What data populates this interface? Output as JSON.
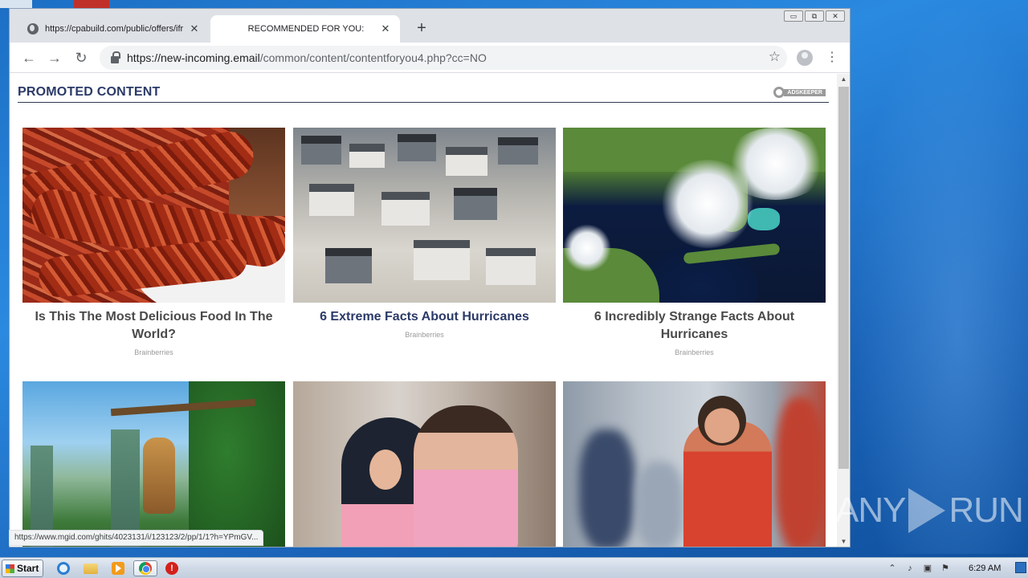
{
  "browser": {
    "tabs": [
      {
        "title": "https://cpabuild.com/public/offers/ifr",
        "active": false
      },
      {
        "title": "RECOMMENDED FOR YOU:",
        "active": true
      }
    ],
    "tab_close_glyph": "✕",
    "new_tab_glyph": "+",
    "window_controls": [
      "▭",
      "⧉",
      "✕"
    ],
    "nav": {
      "back": "←",
      "forward": "→",
      "reload": "↻"
    },
    "url_host": "https://new-incoming.email",
    "url_path": "/common/content/contentforyou4.php?cc=NO",
    "bookmark_glyph": "☆",
    "menu_glyph": "⋮",
    "status_url": "https://www.mgid.com/ghits/4023131/i/123123/2/pp/1/1?h=YPmGV..."
  },
  "page": {
    "section_title": "PROMOTED CONTENT",
    "ad_network": "ADSKEEPER",
    "cards": [
      {
        "title": "Is This The Most Delicious Food In The World?",
        "source": "Brainberries",
        "image": "bacon-photo"
      },
      {
        "title": "6 Extreme Facts About Hurricanes",
        "source": "Brainberries",
        "image": "flooded-houses-photo"
      },
      {
        "title": "6 Incredibly Strange Facts About Hurricanes",
        "source": "Brainberries",
        "image": "hurricane-satellite-photo"
      },
      {
        "title": "",
        "source": "",
        "image": "game-jungle-photo"
      },
      {
        "title": "",
        "source": "",
        "image": "couple-photo"
      },
      {
        "title": "",
        "source": "",
        "image": "footballer-photo"
      }
    ],
    "accent_color": "#2b3a67"
  },
  "taskbar": {
    "start_label": "Start",
    "time": "6:29 AM",
    "tray_icons": [
      "chevron-up-icon",
      "speaker-icon",
      "network-icon",
      "flag-icon"
    ]
  },
  "watermark": {
    "left": "ANY",
    "right": "RUN"
  }
}
